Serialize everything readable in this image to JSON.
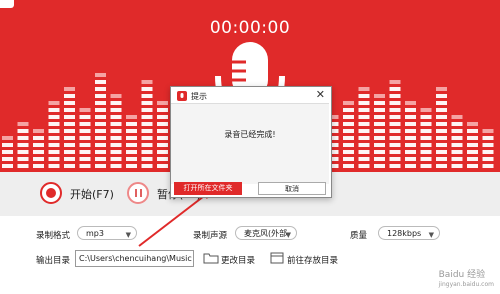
{
  "app": {
    "timer": "00:00:00",
    "colors": {
      "accent": "#e02a2a",
      "light_bar": "#f7b0b0"
    }
  },
  "controls": {
    "record_label": "开始(F7)",
    "pause_label": "暂停(F8)"
  },
  "settings": {
    "format_label": "录制格式",
    "format_value": "mp3",
    "source_label": "录制声源",
    "source_value": "麦克风(外部",
    "quality_label": "质量",
    "quality_value": "128kbps",
    "output_label": "输出目录",
    "output_path": "C:\\Users\\chencuihang\\Music",
    "change_dir_label": "更改目录",
    "goto_dir_label": "前往存放目录"
  },
  "dialog": {
    "title": "提示",
    "close_glyph": "✕",
    "message": "录音已经完成!",
    "open_folder_label": "打开所在文件夹",
    "cancel_label": "取消"
  },
  "watermark": {
    "line1": "Baidu 经验",
    "line2": "jingyan.baidu.com"
  },
  "icons": [
    "microphone-icon",
    "equalizer-icon",
    "record-icon",
    "pause-icon",
    "folder-icon",
    "folder-open-icon",
    "dropdown-caret-icon",
    "close-icon",
    "app-logo-icon"
  ]
}
